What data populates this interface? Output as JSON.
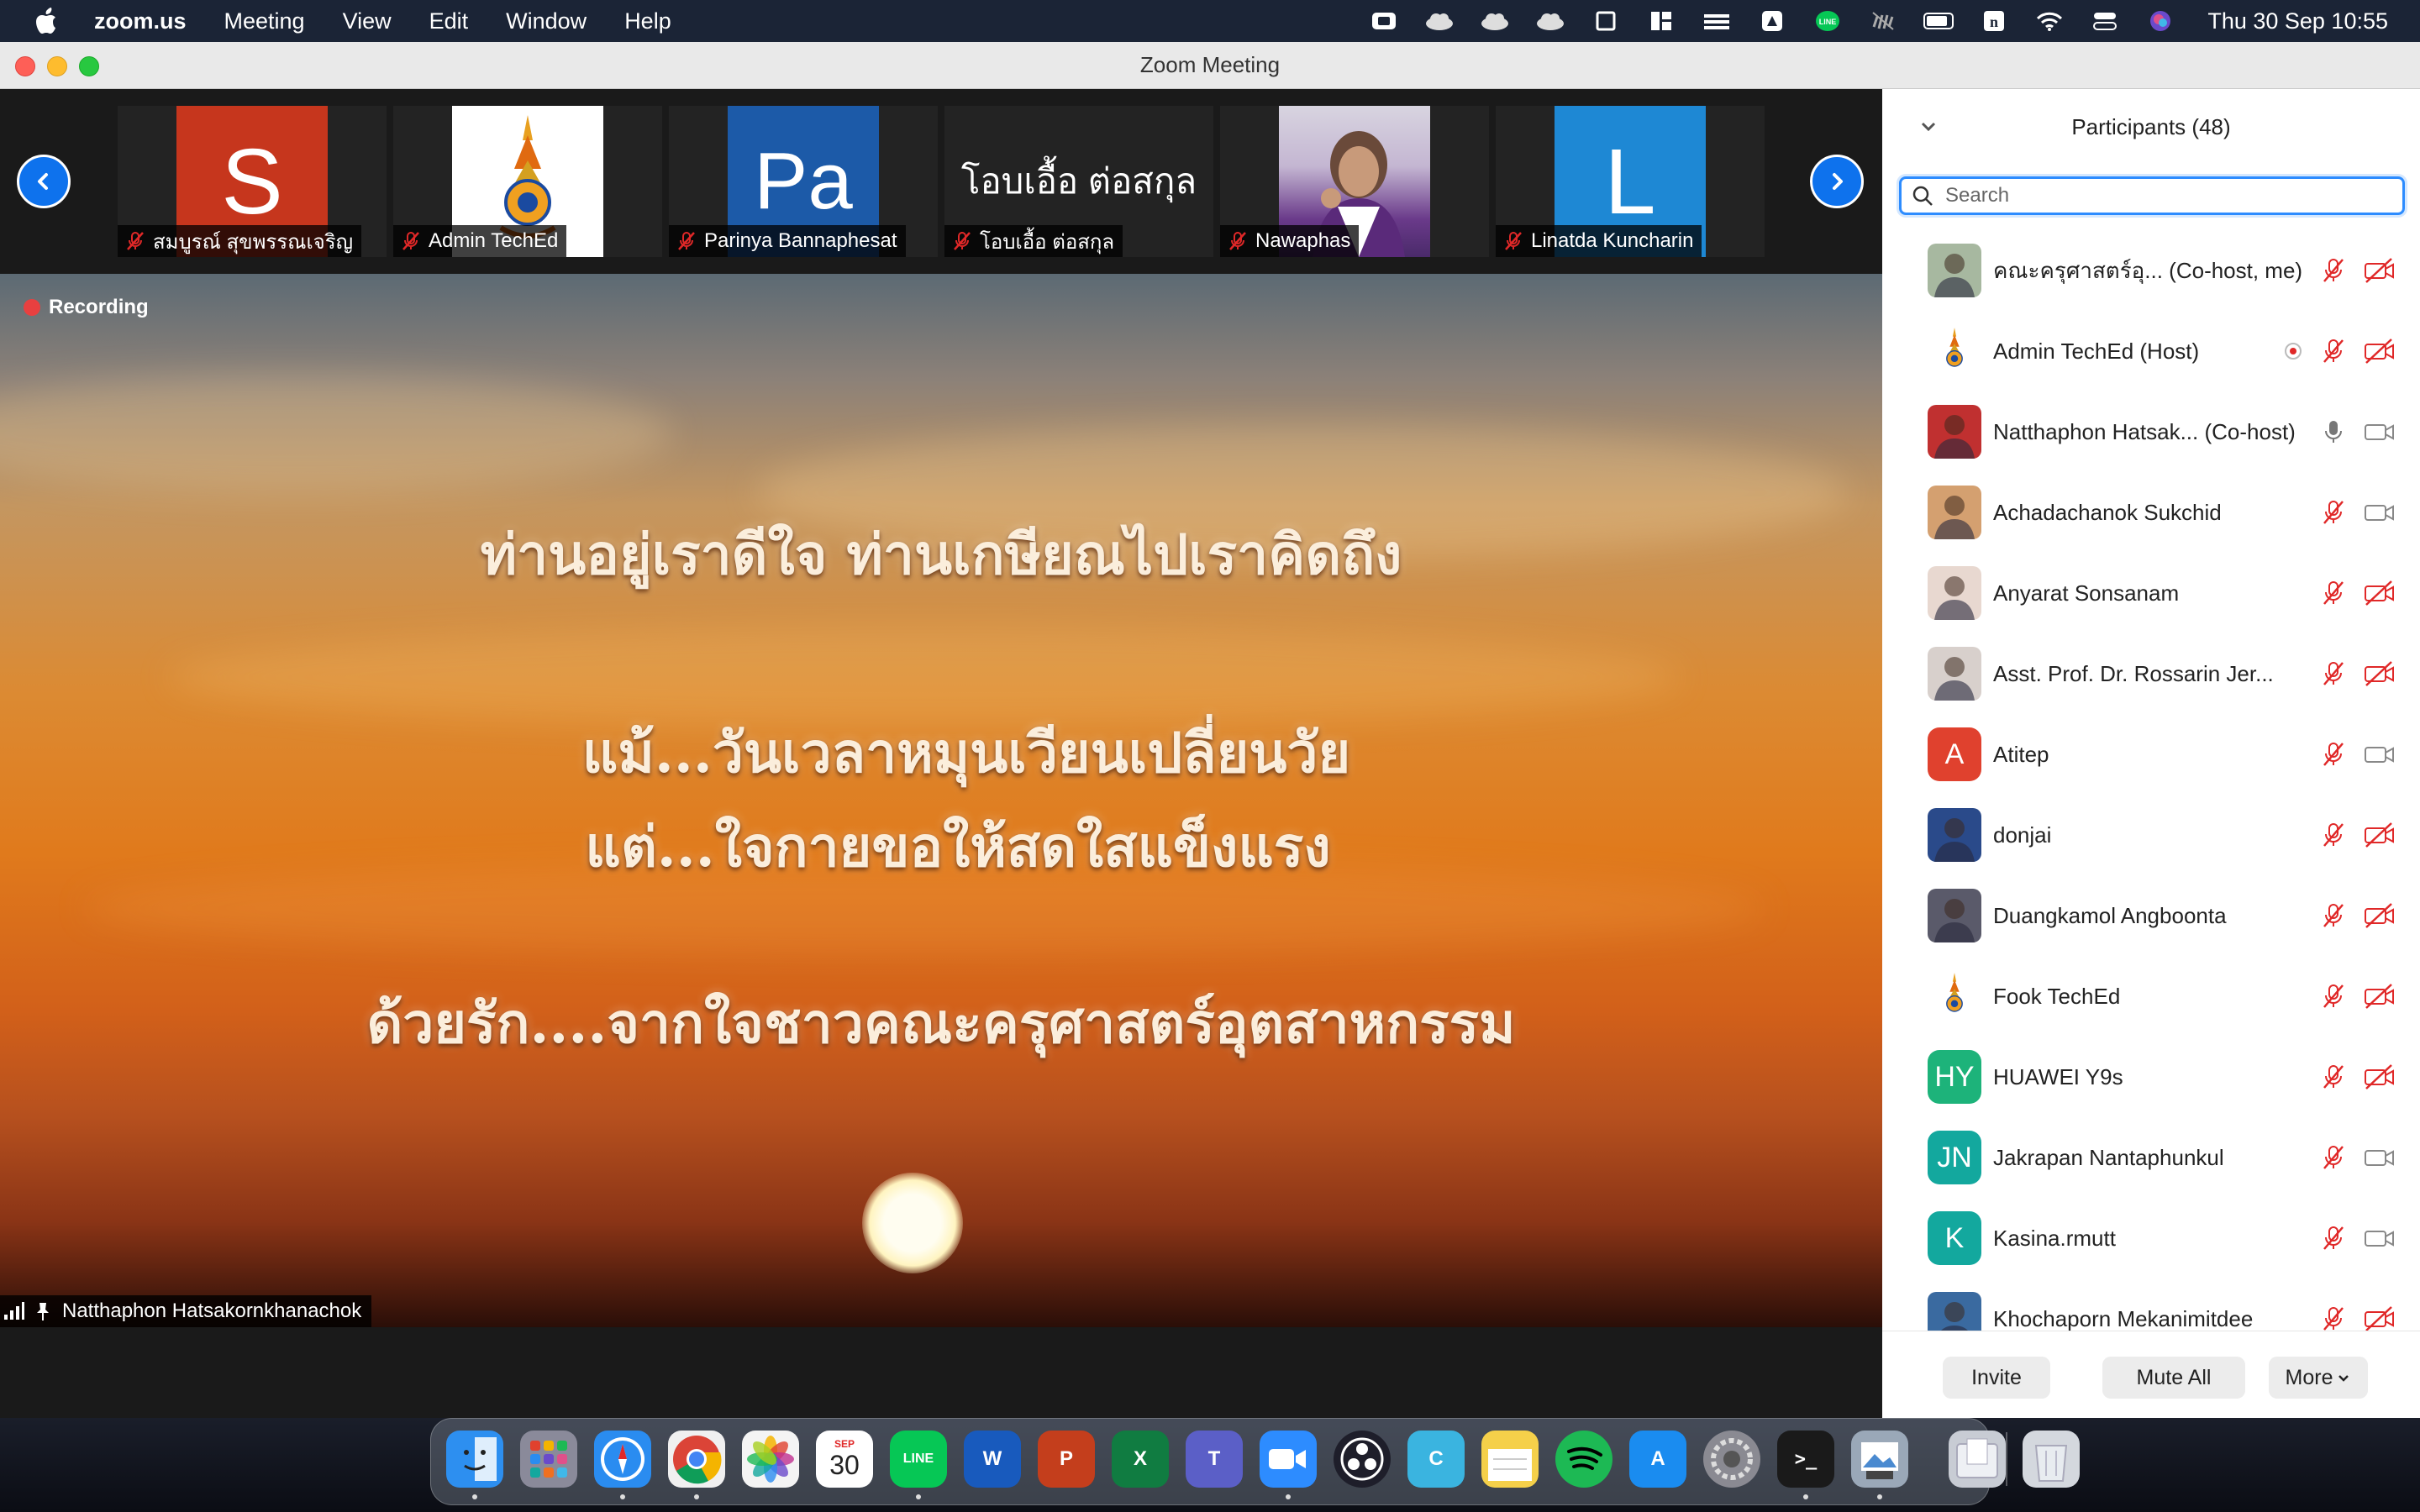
{
  "menubar": {
    "app": "zoom.us",
    "items": [
      "Meeting",
      "View",
      "Edit",
      "Window",
      "Help"
    ],
    "clock": "Thu 30 Sep  10:55"
  },
  "window": {
    "title": "Zoom Meeting"
  },
  "thumbnails": [
    {
      "name": "สมบูรณ์ สุขพรรณเจริญ",
      "tile_text": "S",
      "color": "#c6361d"
    },
    {
      "name": "Admin TechEd",
      "tile_text": "",
      "color": "#ffffff"
    },
    {
      "name": "Parinya Bannaphesat",
      "tile_text": "Pa",
      "color": "#1c5aa8"
    },
    {
      "name": "โอบเอื้อ ต่อสกุล",
      "tile_text": "โอบเอื้อ ต่อสกุล",
      "color": "#232323"
    },
    {
      "name": "Nawaphas",
      "tile_text": "",
      "color": "#c9b8d6"
    },
    {
      "name": "Linatda Kuncharin",
      "tile_text": "L",
      "color": "#1e88d4"
    }
  ],
  "stage": {
    "recording_label": "Recording",
    "lines": [
      "ท่านอยู่เราดีใจ ท่านเกษียณไปเราคิดถึง",
      "แม้...วันเวลาหมุนเวียนเปลี่ยนวัย",
      "แต่...ใจกายขอให้สดใสแข็งแรง",
      "ด้วยรัก....จากใจชาวคณะครุศาสตร์อุตสาหกรรม"
    ],
    "speaker": "Natthaphon Hatsakornkhanachok"
  },
  "participants": {
    "title": "Participants (48)",
    "search_placeholder": "Search",
    "list": [
      {
        "name": "คณะครุศาสตร์อุ...  (Co-host, me)",
        "avatar": "",
        "color": "#a7b8a0",
        "mic": "off",
        "video": "off"
      },
      {
        "name": "Admin TechEd (Host)",
        "avatar": "",
        "color": "#ffffff",
        "mic": "off",
        "video": "off",
        "recording": true
      },
      {
        "name": "Natthaphon Hatsak... (Co-host)",
        "avatar": "",
        "color": "#c03030",
        "mic": "on",
        "video": "on"
      },
      {
        "name": "Achadachanok Sukchid",
        "avatar": "",
        "color": "#d4a070",
        "mic": "off",
        "video": "on"
      },
      {
        "name": "Anyarat Sonsanam",
        "avatar": "",
        "color": "#e8d8d0",
        "mic": "off",
        "video": "off"
      },
      {
        "name": "Asst. Prof. Dr. Rossarin  Jer...",
        "avatar": "",
        "color": "#d8d0cc",
        "mic": "off",
        "video": "off"
      },
      {
        "name": "Atitep",
        "avatar": "A",
        "color": "#e0412e",
        "mic": "off",
        "video": "on"
      },
      {
        "name": "donjai",
        "avatar": "",
        "color": "#2a4a8a",
        "mic": "off",
        "video": "off"
      },
      {
        "name": "Duangkamol Angboonta",
        "avatar": "",
        "color": "#5a5a6a",
        "mic": "off",
        "video": "off"
      },
      {
        "name": "Fook TechEd",
        "avatar": "",
        "color": "#ffffff",
        "mic": "off",
        "video": "off"
      },
      {
        "name": "HUAWEI Y9s",
        "avatar": "HY",
        "color": "#1db37a",
        "mic": "off",
        "video": "off"
      },
      {
        "name": "Jakrapan Nantaphunkul",
        "avatar": "JN",
        "color": "#13a89e",
        "mic": "off",
        "video": "on"
      },
      {
        "name": "Kasina.rmutt",
        "avatar": "K",
        "color": "#13a89e",
        "mic": "off",
        "video": "on"
      },
      {
        "name": "Khochaporn Mekanimitdee",
        "avatar": "",
        "color": "#3a6aa0",
        "mic": "off",
        "video": "off"
      }
    ],
    "invite": "Invite",
    "mute_all": "Mute All",
    "more": "More"
  },
  "dock": [
    {
      "name": "finder",
      "label": "",
      "color": "#2d8ff0"
    },
    {
      "name": "launchpad",
      "label": "",
      "color": "#8a8a9a"
    },
    {
      "name": "safari",
      "label": "",
      "color": "#2a8cf0"
    },
    {
      "name": "chrome",
      "label": "",
      "color": "#f0f0f0"
    },
    {
      "name": "photos",
      "label": "",
      "color": "#f4f4f4"
    },
    {
      "name": "calendar",
      "label": "30",
      "month": "SEP",
      "color": "#ffffff"
    },
    {
      "name": "line",
      "label": "LINE",
      "color": "#06c755"
    },
    {
      "name": "word",
      "label": "W",
      "color": "#185abd"
    },
    {
      "name": "powerpoint",
      "label": "P",
      "color": "#c43e1c"
    },
    {
      "name": "excel",
      "label": "X",
      "color": "#107c41"
    },
    {
      "name": "teams",
      "label": "T",
      "color": "#5b5fc7"
    },
    {
      "name": "zoom",
      "label": "",
      "color": "#2d8cff"
    },
    {
      "name": "obs",
      "label": "",
      "color": "#1e1e2a"
    },
    {
      "name": "canva",
      "label": "C",
      "color": "#3ab4e0"
    },
    {
      "name": "notes",
      "label": "",
      "color": "#f5d04a"
    },
    {
      "name": "spotify",
      "label": "",
      "color": "#1db954"
    },
    {
      "name": "app-store",
      "label": "A",
      "color": "#1a8cf0"
    },
    {
      "name": "system-preferences",
      "label": "",
      "color": "#8a8a92"
    },
    {
      "name": "terminal",
      "label": ">_",
      "color": "#1a1a1a"
    },
    {
      "name": "preview",
      "label": "",
      "color": "#9aa8b8"
    },
    {
      "name": "downloads",
      "label": "",
      "color": "#c8ccd4"
    },
    {
      "name": "trash",
      "label": "",
      "color": "#d4d8de"
    }
  ]
}
